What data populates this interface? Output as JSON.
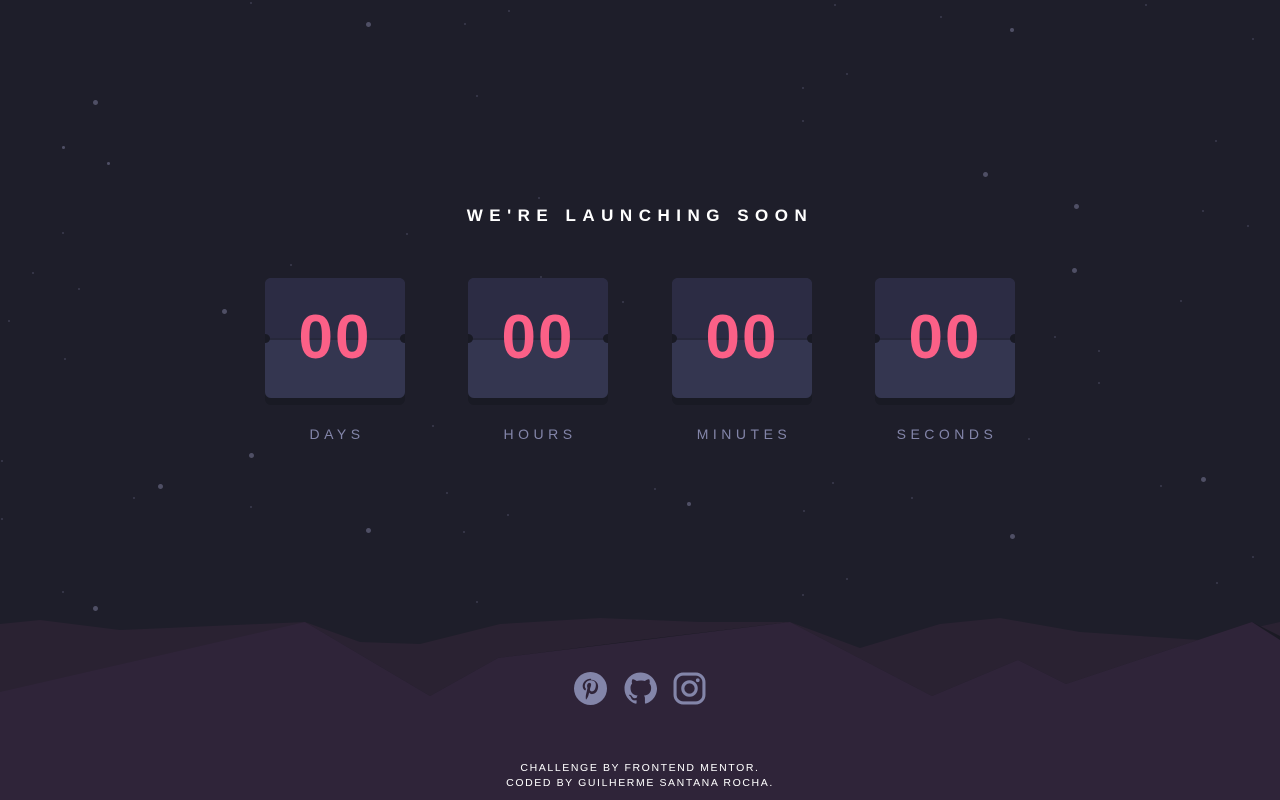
{
  "page": {
    "headline": "WE'RE LAUNCHING SOON"
  },
  "countdown": [
    {
      "value": "00",
      "label": "DAYS"
    },
    {
      "value": "00",
      "label": "HOURS"
    },
    {
      "value": "00",
      "label": "MINUTES"
    },
    {
      "value": "00",
      "label": "SECONDS"
    }
  ],
  "social": [
    {
      "icon": "pinterest-icon"
    },
    {
      "icon": "github-icon"
    },
    {
      "icon": "instagram-icon"
    }
  ],
  "footer": {
    "line1": "CHALLENGE BY FRONTEND MENTOR.",
    "line2": "CODED BY GUILHERME SANTANA ROCHA."
  },
  "colors": {
    "background": "#1e1e2a",
    "card": "#343650",
    "card_top": "#2c2c44",
    "digits": "#fb6087",
    "label": "#8385a9",
    "hills": "#2f2439",
    "icon": "#8385a9"
  }
}
